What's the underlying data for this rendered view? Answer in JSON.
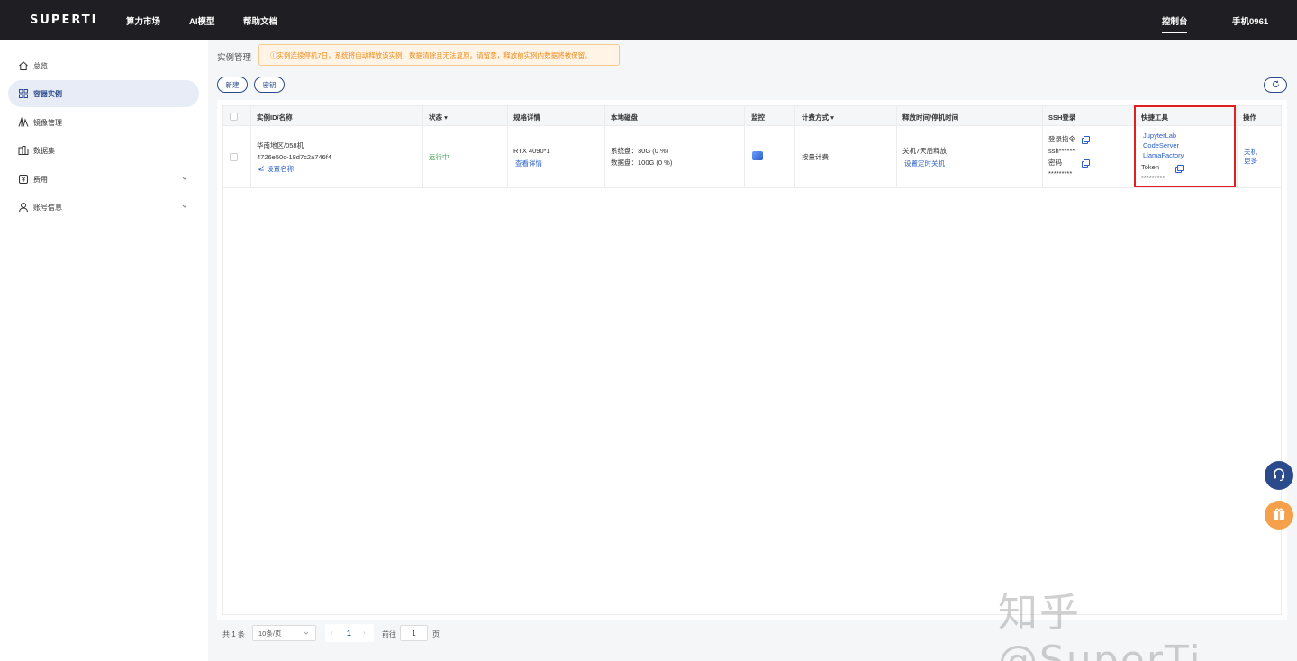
{
  "topbar": {
    "logo": "SUPERTI",
    "nav": [
      "算力市场",
      "AI模型",
      "帮助文档"
    ],
    "console": "控制台",
    "user": "手机0961"
  },
  "sidebar": {
    "items": [
      {
        "label": "总览",
        "icon": "home-icon"
      },
      {
        "label": "容器实例",
        "icon": "grid-icon",
        "active": true
      },
      {
        "label": "镜像管理",
        "icon": "layers-icon"
      },
      {
        "label": "数据集",
        "icon": "database-icon"
      },
      {
        "label": "费用",
        "icon": "billing-icon",
        "expandable": true
      },
      {
        "label": "账号信息",
        "icon": "user-icon",
        "expandable": true
      }
    ]
  },
  "main": {
    "page_title": "实例管理",
    "notice": "ⓘ实例连续停机7日，系统将自动释放该实例，数据清除且无法复原。请留意，释放前实例内数据将被保留。",
    "buttons": {
      "new": "新建",
      "key": "密钥"
    },
    "table": {
      "headers": {
        "id": "实例ID/名称",
        "status": "状态",
        "spec": "规格详情",
        "disk": "本地磁盘",
        "monitor": "监控",
        "billing": "计费方式",
        "release": "释放时间/停机时间",
        "ssh": "SSH登录",
        "tools": "快捷工具",
        "actions": "操作"
      },
      "row": {
        "region": "华南地区/058机",
        "instance_id": "4726e50c-18d7c2a746f4",
        "set_name": "设置名称",
        "status": "运行中",
        "gpu": "RTX 4090*1",
        "view_detail": "查看详情",
        "sys_disk": "系统盘：30G (0 %)",
        "data_disk": "数据盘：100G (0 %)",
        "billing": "按量计费",
        "release": "关机7天后释放",
        "set_shutdown": "设置定时关机",
        "ssh_cmd_label": "登录指令",
        "ssh_cmd": "ssh******",
        "pwd_label": "密码",
        "pwd": "*********",
        "tool_jupyter": "JupyterLab",
        "tool_code": "CodeServer",
        "tool_llama": "LlamaFactory",
        "token_label": "Token",
        "token": "*********",
        "action_shutdown": "关机",
        "action_more": "更多"
      }
    }
  },
  "pagination": {
    "total": "共 1 条",
    "page_size": "10条/页",
    "current": "1",
    "goto_label": "前往",
    "goto_value": "1",
    "page_unit": "页"
  },
  "watermark": "知乎 @SuperTi",
  "colors": {
    "accent": "#2b4a8c",
    "link": "#2b5fc4",
    "running": "#3ba14a",
    "highlight": "#e02020",
    "notice": "#f08c1a"
  }
}
